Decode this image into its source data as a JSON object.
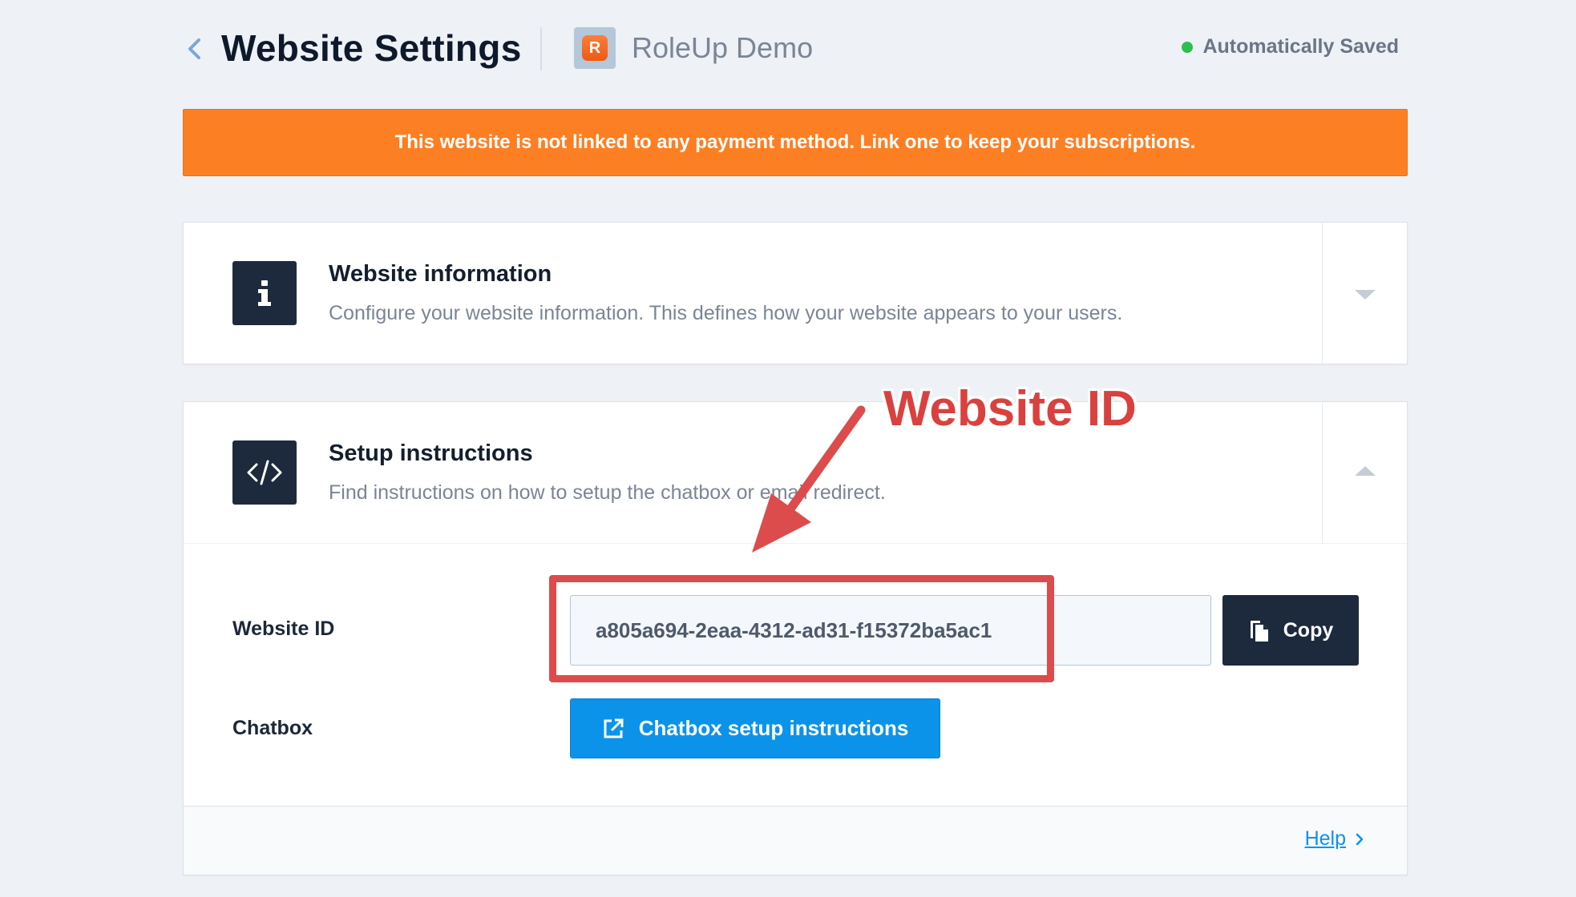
{
  "header": {
    "title": "Website Settings",
    "site_logo_letter": "R",
    "site_name": "RoleUp Demo",
    "save_status": "Automatically Saved",
    "save_status_color": "#2dbf4e"
  },
  "banner": {
    "text": "This website is not linked to any payment method. Link one to keep your subscriptions.",
    "color": "#fd7f23"
  },
  "sections": {
    "info": {
      "icon": "info-icon",
      "title": "Website information",
      "description": "Configure your website information. This defines how your website appears to your users.",
      "expanded": false
    },
    "setup": {
      "icon": "code-icon",
      "title": "Setup instructions",
      "description": "Find instructions on how to setup the chatbox or email redirect.",
      "expanded": true,
      "website_id_label": "Website ID",
      "website_id_value": "a805a694-2eaa-4312-ad31-f15372ba5ac1",
      "copy_label": "Copy",
      "chatbox_label": "Chatbox",
      "chatbox_button_label": "Chatbox setup instructions"
    }
  },
  "footer": {
    "help_label": "Help"
  },
  "annotation": {
    "label": "Website ID",
    "color": "#dc4c4c"
  }
}
